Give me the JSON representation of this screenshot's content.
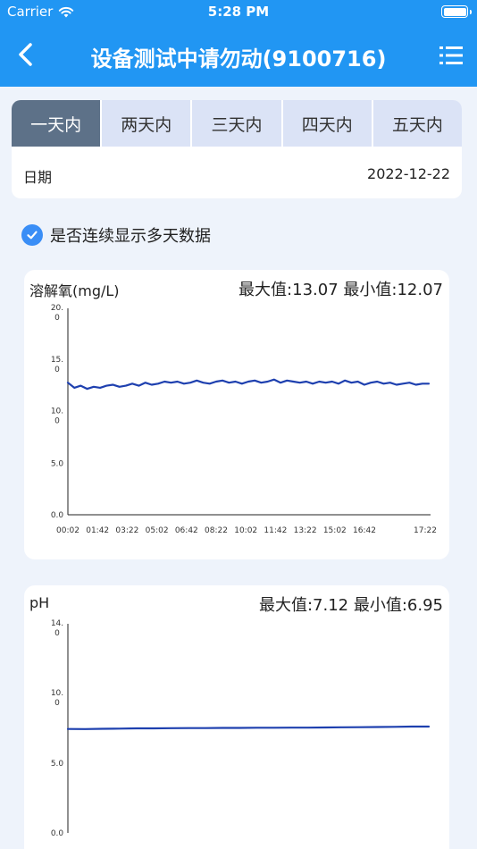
{
  "status_bar": {
    "carrier": "Carrier",
    "time": "5:28 PM"
  },
  "nav": {
    "title": "设备测试中请勿动(9100716)",
    "back_icon": "chevron-left-icon",
    "menu_icon": "list-menu-icon"
  },
  "range_tabs": {
    "items": [
      "一天内",
      "两天内",
      "三天内",
      "四天内",
      "五天内"
    ],
    "active_index": 0
  },
  "date": {
    "label": "日期",
    "value": "2022-12-22"
  },
  "continuous_option": {
    "label": "是否连续显示多天数据",
    "checked": true
  },
  "theme": {
    "primary": "#2196f3",
    "tab_active": "#5d7188",
    "tab_inactive": "#dbe3f6",
    "series_color": "#1e40af",
    "background": "#eef3fb"
  },
  "charts": [
    {
      "title": "溶解氧(mg/L)",
      "max_label": "最大值:",
      "max_value": "13.07",
      "min_label": "最小值:",
      "min_value": "12.07",
      "y_ticks": [
        [
          "20.",
          "0"
        ],
        [
          "15.",
          "0"
        ],
        [
          "10.",
          "0"
        ],
        [
          "5.0"
        ],
        [
          "0.0"
        ]
      ],
      "x_ticks": [
        "00:02",
        "01:42",
        "03:22",
        "05:02",
        "06:42",
        "08:22",
        "10:02",
        "11:42",
        "13:22",
        "15:02",
        "16:42",
        "17:22"
      ]
    },
    {
      "title": "pH",
      "max_label": "最大值:",
      "max_value": "7.12",
      "min_label": "最小值:",
      "min_value": "6.95",
      "y_ticks": [
        [
          "14.",
          "0"
        ],
        [
          "10.",
          "0"
        ],
        [
          "5.0"
        ],
        [
          "0.0"
        ]
      ],
      "x_ticks": []
    }
  ],
  "chart_data": [
    {
      "type": "line",
      "title": "溶解氧(mg/L)",
      "ylim": [
        0,
        20
      ],
      "x_tick_labels": [
        "00:02",
        "01:42",
        "03:22",
        "05:02",
        "06:42",
        "08:22",
        "10:02",
        "11:42",
        "13:22",
        "15:02",
        "16:42",
        "17:22"
      ],
      "grid": false,
      "series": [
        {
          "values": [
            12.8,
            12.3,
            12.5,
            12.2,
            12.4,
            12.3,
            12.5,
            12.6,
            12.4,
            12.5,
            12.7,
            12.5,
            12.8,
            12.6,
            12.7,
            12.9,
            12.8,
            12.9,
            12.7,
            12.8,
            13.0,
            12.8,
            12.7,
            12.9,
            13.0,
            12.8,
            12.9,
            12.7,
            12.9,
            13.0,
            12.8,
            12.9,
            13.1,
            12.8,
            13.0,
            12.9,
            12.8,
            12.9,
            12.7,
            12.9,
            12.8,
            12.9,
            12.7,
            13.0,
            12.8,
            12.9,
            12.6,
            12.8,
            12.9,
            12.7,
            12.8,
            12.6,
            12.7,
            12.8,
            12.6,
            12.7,
            12.7
          ]
        }
      ]
    },
    {
      "type": "line",
      "title": "pH",
      "ylim": [
        0,
        14
      ],
      "grid": false,
      "series": [
        {
          "values": [
            6.96,
            6.95,
            6.97,
            6.98,
            7.0,
            7.0,
            7.01,
            7.02,
            7.02,
            7.03,
            7.03,
            7.04,
            7.04,
            7.05,
            7.05,
            7.06,
            7.07,
            7.08,
            7.09,
            7.1,
            7.12,
            7.12
          ]
        }
      ]
    }
  ]
}
